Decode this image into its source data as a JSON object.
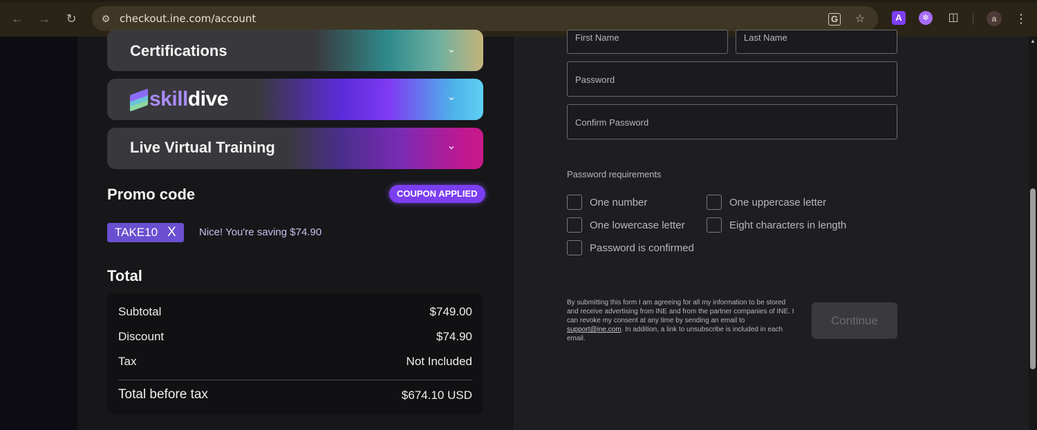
{
  "browser": {
    "url": "checkout.ine.com/account",
    "extension_a_label": "A",
    "avatar_initial": "a"
  },
  "left": {
    "accordions": [
      {
        "title": "Certifications"
      },
      {
        "logo_skill": "skill",
        "logo_dive": "dive"
      },
      {
        "title": "Live Virtual Training"
      }
    ],
    "promo": {
      "heading": "Promo code",
      "badge": "COUPON APPLIED",
      "code": "TAKE10",
      "remove": "X",
      "note": "Nice! You're saving $74.90"
    },
    "total": {
      "heading": "Total",
      "rows": [
        {
          "label": "Subtotal",
          "value": "$749.00"
        },
        {
          "label": "Discount",
          "value": "$74.90"
        },
        {
          "label": "Tax",
          "value": "Not Included"
        }
      ],
      "summary": {
        "label": "Total before tax",
        "value": "$674.10 USD"
      }
    }
  },
  "form": {
    "first_name_placeholder": "First Name",
    "last_name_placeholder": "Last Name",
    "password_placeholder": "Password",
    "confirm_password_placeholder": "Confirm Password",
    "requirements_title": "Password requirements",
    "requirements": [
      "One number",
      "One uppercase letter",
      "One lowercase letter",
      "Eight characters in length",
      "Password is confirmed"
    ],
    "legal_pre": "By submitting this form I am agreeing for all my information to be stored and receive advertising from INE and from the partner companies of INE. I can revoke my consent at any time by sending an email to ",
    "legal_link": "support@ine.com",
    "legal_post": ". In addition, a link to unsubscribe is included in each email.",
    "continue_label": "Continue"
  }
}
